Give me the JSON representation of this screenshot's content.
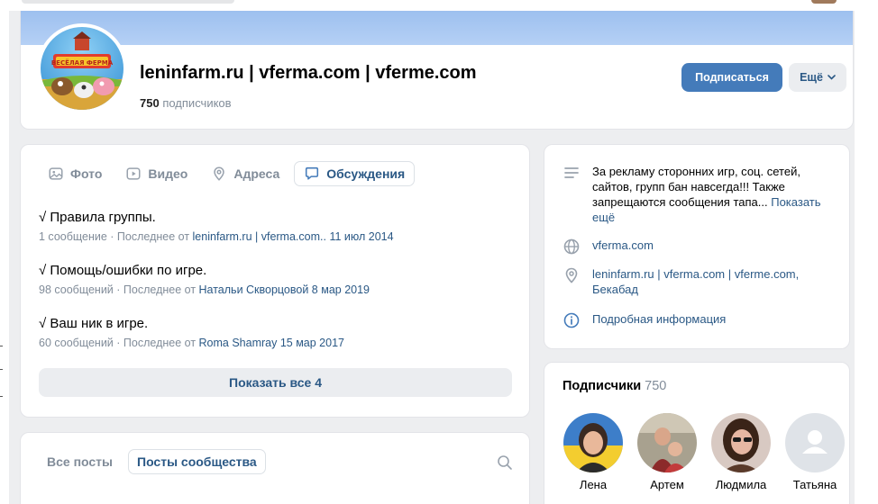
{
  "group": {
    "title": "leninfarm.ru | vferma.com | vferme.com",
    "subscribers_count": "750",
    "subscribers_label": "подписчиков",
    "subscribe_button": "Подписаться",
    "more_button": "Ещё",
    "avatar_text": "ВЕСЁЛАЯ ФЕРМА"
  },
  "tabs": [
    {
      "label": "Фото",
      "icon": "photo-icon"
    },
    {
      "label": "Видео",
      "icon": "video-icon"
    },
    {
      "label": "Адреса",
      "icon": "location-icon"
    },
    {
      "label": "Обсуждения",
      "icon": "discussion-icon",
      "active": true
    }
  ],
  "topics": [
    {
      "title": "√ Правила группы.",
      "count": "1 сообщение",
      "sep": " · Последнее от ",
      "author": "leninfarm.ru | vferma.com..",
      "date": " 11 июл 2014"
    },
    {
      "title": "√ Помощь/ошибки по игре.",
      "count": "98 сообщений",
      "sep": " · Последнее от ",
      "author": "Натальи Скворцовой",
      "date": " 8 мар 2019"
    },
    {
      "title": "√ Ваш ник в игре.",
      "count": "60 сообщений",
      "sep": " · Последнее от ",
      "author": "Roma Shamray",
      "date": " 15 мар 2017"
    }
  ],
  "show_all_button": "Показать все 4",
  "posts": {
    "tab_all": "Все посты",
    "tab_community": "Посты сообщества"
  },
  "info": {
    "description": "За рекламу сторонних игр, соц. сетей, сайтов, групп бан навсегда!!! Также запрещаются сообщения тапа...",
    "show_more": "Показать ещё",
    "website": "vferma.com",
    "address": "leninfarm.ru | vferma.com | vferme.com, Бекабад",
    "details": "Подробная информация"
  },
  "subscribers": {
    "title": "Подписчики",
    "count": "750",
    "people": [
      {
        "name": "Лена"
      },
      {
        "name": "Артем"
      },
      {
        "name": "Людмила"
      },
      {
        "name": "Татьяна"
      }
    ]
  },
  "colors": {
    "accent": "#447bba",
    "link": "#2a5885",
    "muted": "#818c99",
    "page_bg": "#edeef0"
  }
}
